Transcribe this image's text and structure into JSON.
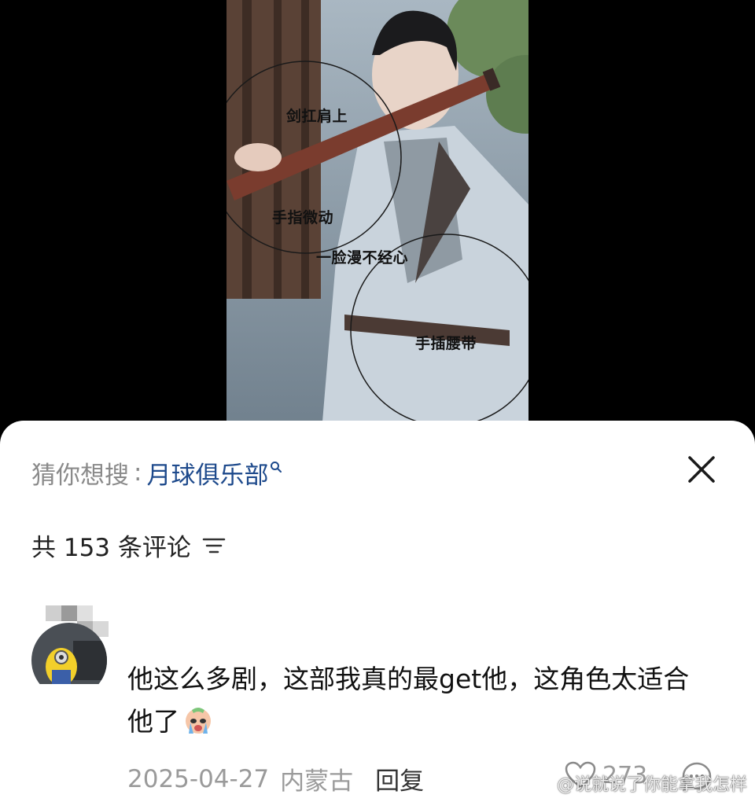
{
  "video": {
    "annotations": [
      "剑扛肩上",
      "手指微动",
      "一脸漫不经心",
      "手插腰带"
    ]
  },
  "search": {
    "label": "猜你想搜",
    "colon": ":",
    "term": "月球俱乐部"
  },
  "comments": {
    "count_text": "共 153 条评论"
  },
  "comment": {
    "text": "他这么多剧，这部我真的最get他，这角色太适合他了",
    "date": "2025-04-27",
    "location": "内蒙古",
    "reply_label": "回复",
    "like_count": "273"
  },
  "watermark": {
    "text": "@说就说了你能拿我怎样"
  },
  "colors": {
    "link": "#1e4a8c",
    "muted": "#9a9a9a",
    "text": "#111111"
  }
}
